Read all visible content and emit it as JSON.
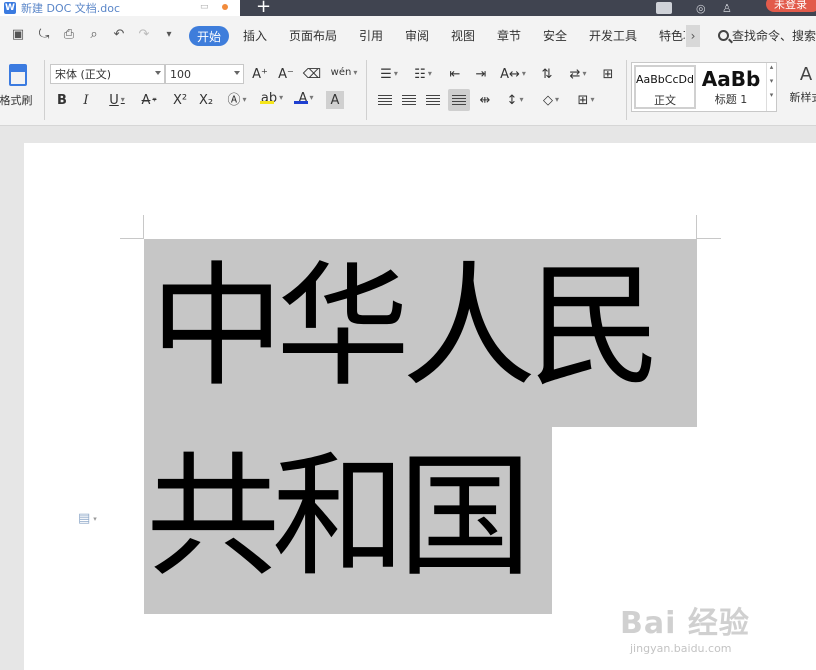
{
  "titlebar": {
    "doc_tab_icon": "W",
    "doc_tab_label": "新建 DOC 文档.doc",
    "new_tab_symbol": "+",
    "login_label": "未登录"
  },
  "menubar": {
    "tabs": [
      "开始",
      "插入",
      "页面布局",
      "引用",
      "审阅",
      "视图",
      "章节",
      "安全",
      "开发工具",
      "特色功"
    ],
    "active_tab": "开始",
    "search_label": "查找命令、搜索"
  },
  "ribbon": {
    "format_painter_label": "格式刷",
    "font_name": "宋体 (正文)",
    "font_size": "100",
    "styles": {
      "normal_sample": "AaBbCcDd",
      "normal_name": "正文",
      "heading_sample": "AaBb",
      "heading_name": "标题 1"
    },
    "new_style_label": "新样式",
    "colors": {
      "accent": "#3e7ddb",
      "highlight": "#f5e51a",
      "font_color": "#1e3fd0",
      "selection": "#c6c6c6"
    }
  },
  "document": {
    "line1": "中华人民",
    "line2": "共和国"
  },
  "watermark": {
    "main": "Bai 经验",
    "sub": "jingyan.baidu.com"
  }
}
